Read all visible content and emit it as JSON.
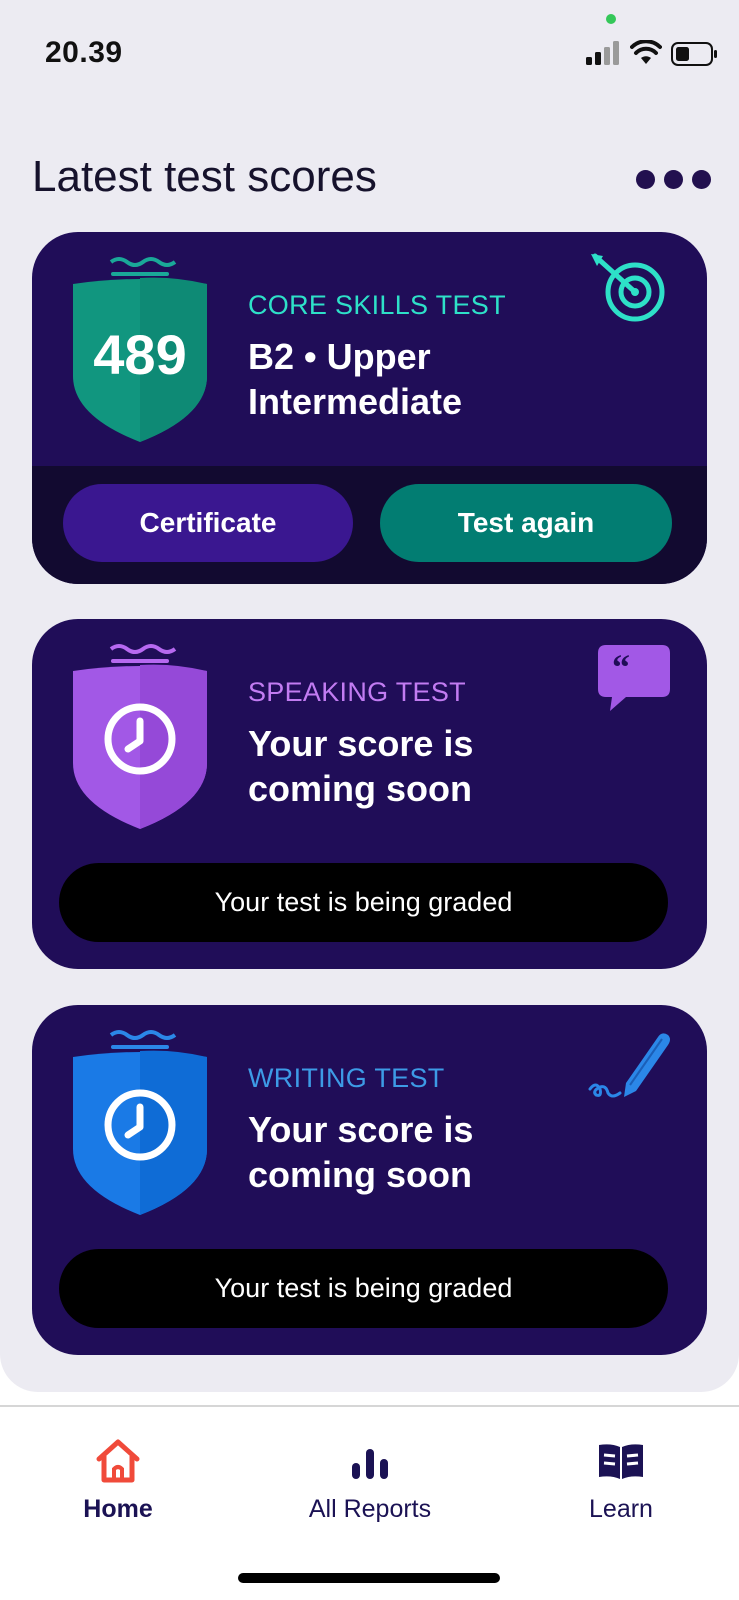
{
  "status_bar": {
    "time": "20.39"
  },
  "header": {
    "title": "Latest test scores"
  },
  "cards": {
    "core": {
      "score": "489",
      "label": "CORE SKILLS TEST",
      "level": "B2 • Upper Intermediate",
      "certificate_label": "Certificate",
      "test_again_label": "Test again",
      "accent": "#2ee0c8",
      "shield_color": "#11967f"
    },
    "speaking": {
      "label": "SPEAKING TEST",
      "message": "Your score is coming soon",
      "status": "Your test is being graded",
      "accent": "#b769f0",
      "shield_color": "#9b4ee0"
    },
    "writing": {
      "label": "WRITING TEST",
      "message": "Your score is coming soon",
      "status": "Your test is being graded",
      "accent": "#3d9be6",
      "shield_color": "#1673dc"
    }
  },
  "nav": {
    "home": "Home",
    "reports": "All Reports",
    "learn": "Learn"
  },
  "colors": {
    "card_bg": "#200d58",
    "home_icon": "#f04a3a",
    "nav_text": "#1b1254"
  },
  "icons": [
    "signal-icon",
    "wifi-icon",
    "battery-icon",
    "more-icon",
    "target-icon",
    "quote-bubble-icon",
    "pen-icon",
    "clock-icon",
    "home-icon",
    "bar-chart-icon",
    "book-icon"
  ]
}
